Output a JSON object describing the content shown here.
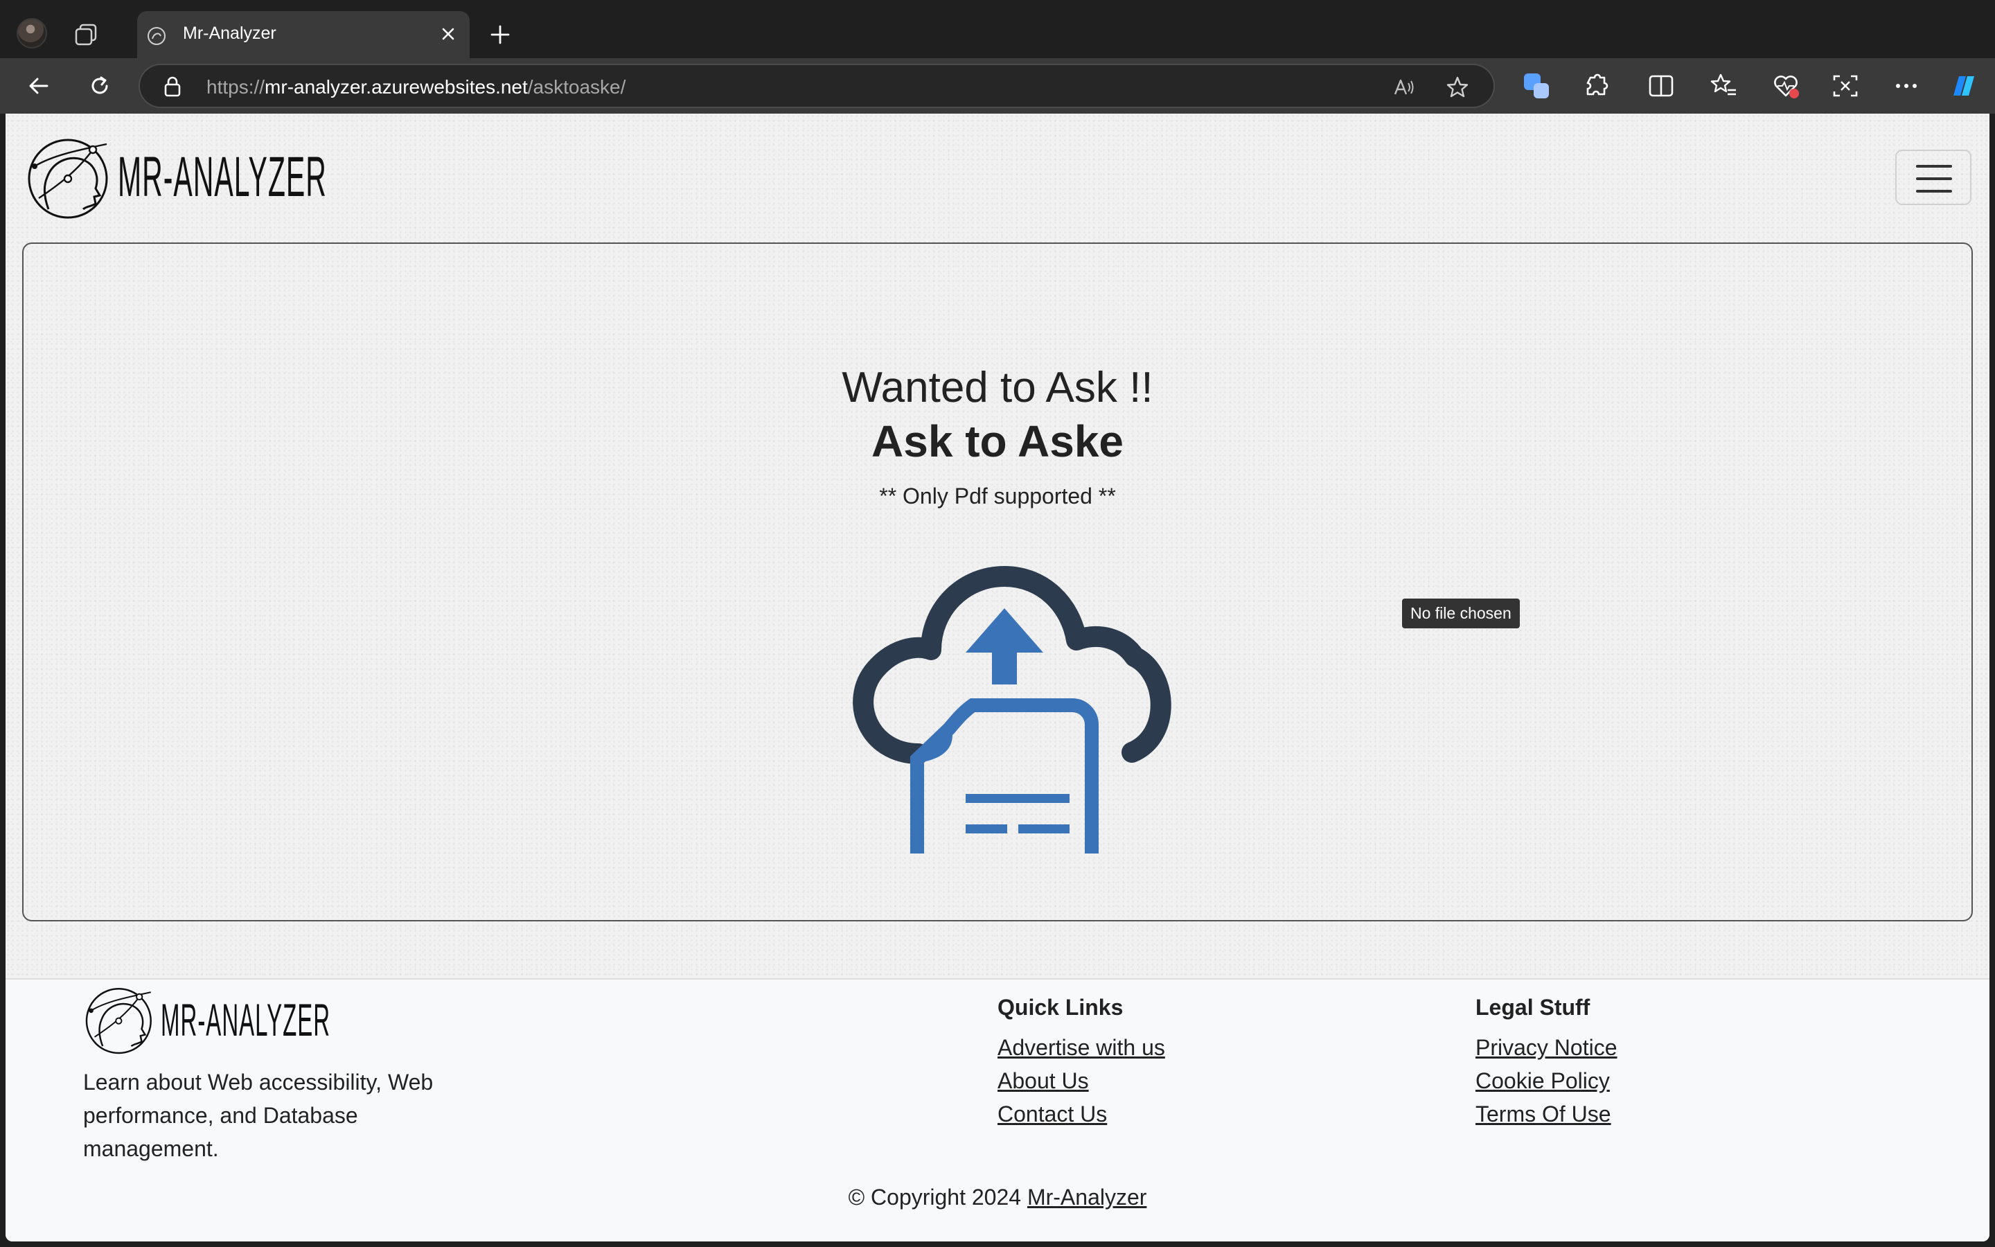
{
  "browser": {
    "tab_title": "Mr-Analyzer",
    "url_scheme": "https://",
    "url_host": "mr-analyzer.azurewebsites.net",
    "url_path": "/asktoaske/"
  },
  "site": {
    "brand": "MR-ANALYZER",
    "heading_line1": "Wanted to Ask !!",
    "heading_line2": "Ask to Aske",
    "note": "** Only Pdf supported **",
    "file_input_tooltip": "No file chosen",
    "colors": {
      "cloud": "#2c3b4d",
      "document": "#3b73b9"
    }
  },
  "footer": {
    "brand": "MR-ANALYZER",
    "description": "Learn about Web accessibility, Web performance, and Database management.",
    "quick_links_heading": "Quick Links",
    "quick_links": [
      "Advertise with us",
      "About Us",
      "Contact Us"
    ],
    "legal_heading": "Legal Stuff",
    "legal_links": [
      "Privacy Notice",
      "Cookie Policy",
      "Terms Of Use"
    ],
    "copyright_prefix": "© Copyright 2024",
    "copyright_link": "Mr-Analyzer"
  }
}
